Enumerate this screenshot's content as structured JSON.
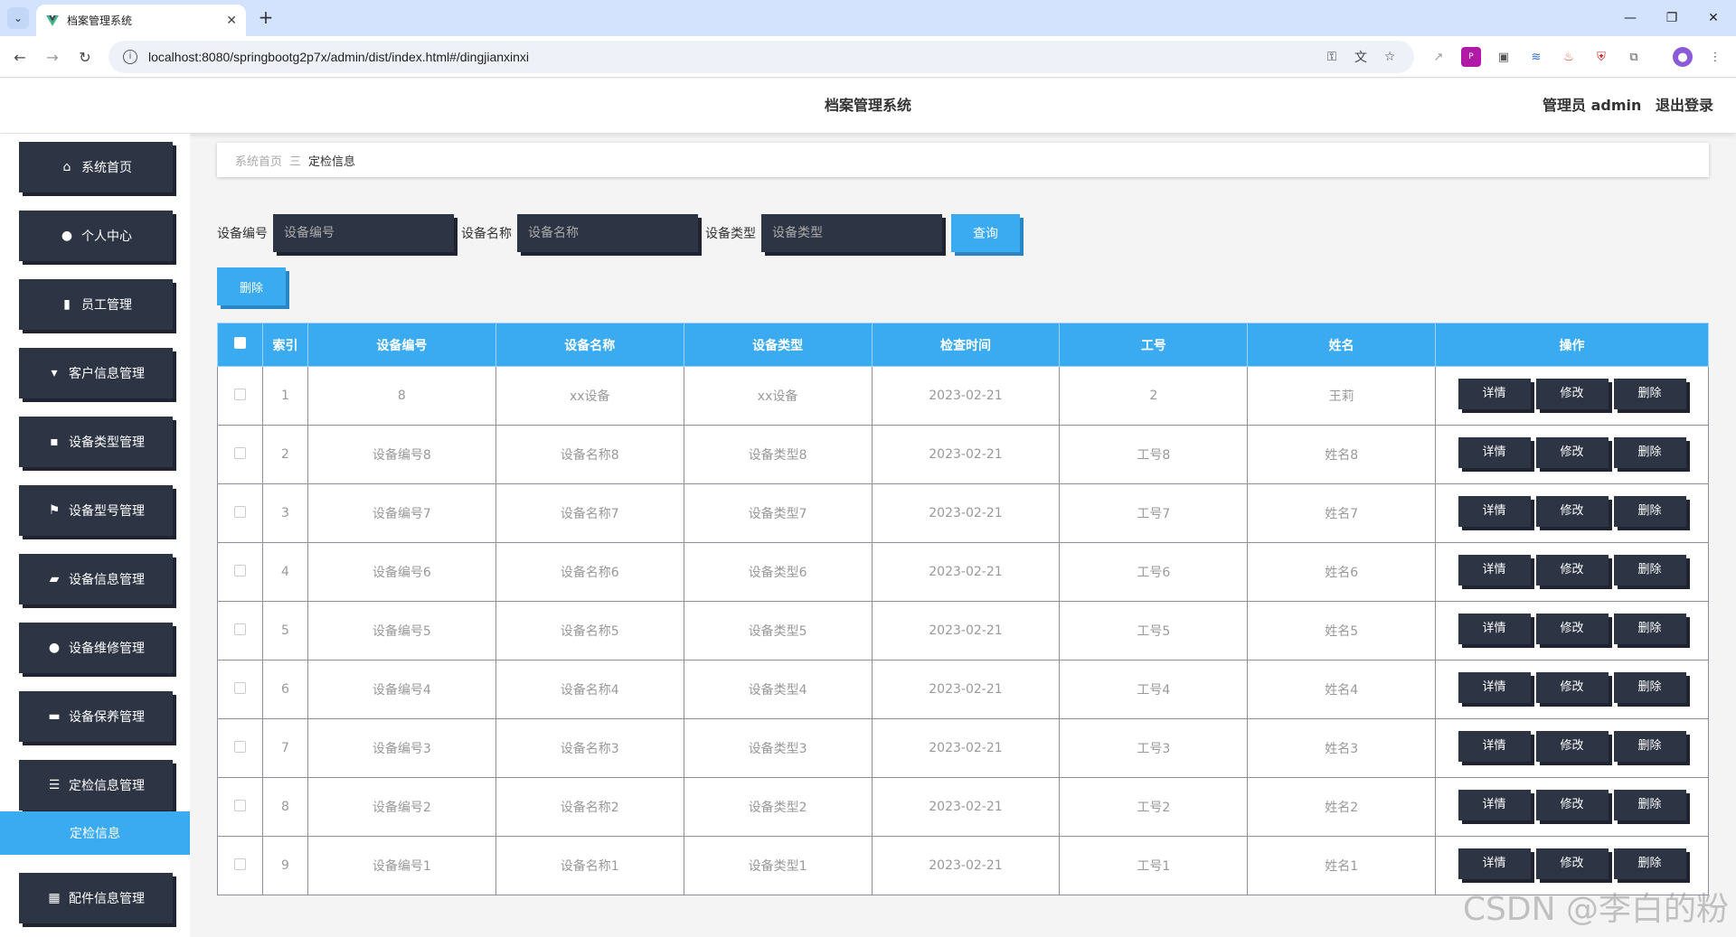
{
  "browser": {
    "tab_title": "档案管理系统",
    "url": "localhost:8080/springbootg2p7x/admin/dist/index.html#/dingjianxinxi"
  },
  "header": {
    "title": "档案管理系统",
    "user_role": "管理员 admin",
    "logout": "退出登录"
  },
  "sidebar": {
    "items": [
      {
        "label": "系统首页",
        "icon": "home-icon"
      },
      {
        "label": "个人中心",
        "icon": "user-icon"
      },
      {
        "label": "员工管理",
        "icon": "book-icon"
      },
      {
        "label": "客户信息管理",
        "icon": "chat-icon"
      },
      {
        "label": "设备类型管理",
        "icon": "message-icon"
      },
      {
        "label": "设备型号管理",
        "icon": "flag-icon"
      },
      {
        "label": "设备信息管理",
        "icon": "briefcase-icon"
      },
      {
        "label": "设备维修管理",
        "icon": "user-icon"
      },
      {
        "label": "设备保养管理",
        "icon": "ticket-icon"
      },
      {
        "label": "定检信息管理",
        "icon": "list-icon"
      },
      {
        "label": "配件信息管理",
        "icon": "grid-icon"
      }
    ],
    "active_sub": "定检信息"
  },
  "breadcrumb": {
    "home": "系统首页",
    "separator": "三",
    "current": "定检信息"
  },
  "search": {
    "code_label": "设备编号",
    "code_placeholder": "设备编号",
    "name_label": "设备名称",
    "name_placeholder": "设备名称",
    "type_label": "设备类型",
    "type_placeholder": "设备类型",
    "query": "查询"
  },
  "actions": {
    "delete": "删除"
  },
  "table": {
    "headers": [
      "索引",
      "设备编号",
      "设备名称",
      "设备类型",
      "检查时间",
      "工号",
      "姓名",
      "操作"
    ],
    "rows": [
      [
        "1",
        "8",
        "xx设备",
        "xx设备",
        "2023-02-21",
        "2",
        "王莉"
      ],
      [
        "2",
        "设备编号8",
        "设备名称8",
        "设备类型8",
        "2023-02-21",
        "工号8",
        "姓名8"
      ],
      [
        "3",
        "设备编号7",
        "设备名称7",
        "设备类型7",
        "2023-02-21",
        "工号7",
        "姓名7"
      ],
      [
        "4",
        "设备编号6",
        "设备名称6",
        "设备类型6",
        "2023-02-21",
        "工号6",
        "姓名6"
      ],
      [
        "5",
        "设备编号5",
        "设备名称5",
        "设备类型5",
        "2023-02-21",
        "工号5",
        "姓名5"
      ],
      [
        "6",
        "设备编号4",
        "设备名称4",
        "设备类型4",
        "2023-02-21",
        "工号4",
        "姓名4"
      ],
      [
        "7",
        "设备编号3",
        "设备名称3",
        "设备类型3",
        "2023-02-21",
        "工号3",
        "姓名3"
      ],
      [
        "8",
        "设备编号2",
        "设备名称2",
        "设备类型2",
        "2023-02-21",
        "工号2",
        "姓名2"
      ],
      [
        "9",
        "设备编号1",
        "设备名称1",
        "设备类型1",
        "2023-02-21",
        "工号1",
        "姓名1"
      ]
    ],
    "row_actions": [
      "详情",
      "修改",
      "删除"
    ]
  },
  "watermark": "CSDN @李白的粉",
  "colors": {
    "accent": "#3aaaf1",
    "dark_button": "#2d3444"
  }
}
